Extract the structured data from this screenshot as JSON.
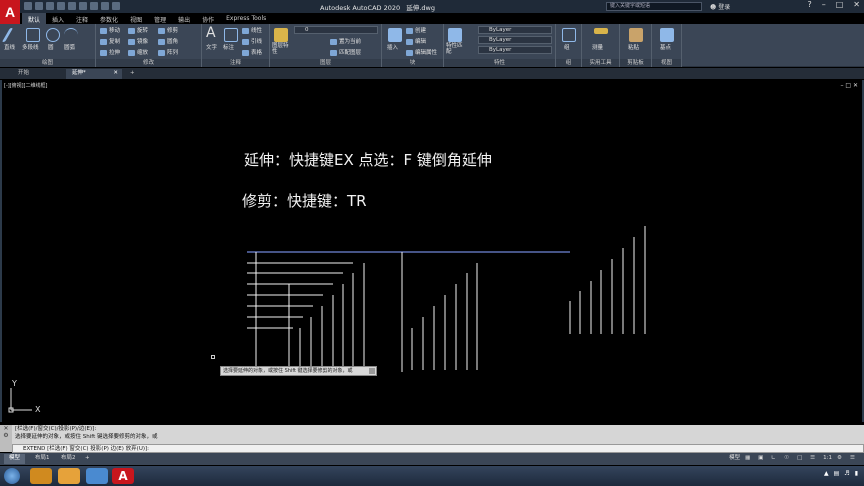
{
  "app": {
    "logo_text": "A",
    "title": "Autodesk AutoCAD 2020",
    "filename": "延伸.dwg",
    "search_placeholder": "键入关键字或短语",
    "login": "登录"
  },
  "ribbon_tabs": [
    "默认",
    "插入",
    "注释",
    "参数化",
    "视图",
    "管理",
    "输出",
    "协作",
    "Express Tools"
  ],
  "ribbon": {
    "draw": {
      "title": "绘图",
      "line": "直线",
      "polyline": "多段线",
      "circle": "圆",
      "arc": "圆弧"
    },
    "modify": {
      "title": "修改",
      "move": "移动",
      "rotate": "旋转",
      "trim": "修剪",
      "copy": "复制",
      "mirror": "镜像",
      "fillet": "圆角",
      "stretch": "拉伸",
      "scale": "缩放",
      "array": "阵列"
    },
    "annotation": {
      "title": "注释",
      "text": "文字",
      "dimension": "标注",
      "linear": "线性",
      "leader": "引线",
      "table": "表格"
    },
    "layers": {
      "title": "图层",
      "props": "图层特性",
      "layer_value": "0",
      "make_current": "置为当前",
      "match": "匹配图层"
    },
    "block": {
      "title": "块",
      "insert": "插入",
      "create": "创建",
      "edit": "编辑",
      "edit_attr": "编辑属性"
    },
    "properties": {
      "title": "特性",
      "match": "特性匹配",
      "color": "ByLayer",
      "linetype": "ByLayer",
      "lineweight": "ByLayer"
    },
    "groups": {
      "title": "组",
      "group": "组"
    },
    "utilities": {
      "title": "实用工具",
      "measure": "测量"
    },
    "clipboard": {
      "title": "剪贴板",
      "paste": "粘贴"
    },
    "view": {
      "title": "视图",
      "base": "基点"
    }
  },
  "doc_tabs": {
    "start": "开始",
    "current": "延伸*"
  },
  "viewport_label": "[-][俯视][二维线框]",
  "notes": {
    "line1": "延伸：快捷键EX   点选：F 键倒角延伸",
    "line2": "修剪：快捷键：TR"
  },
  "tooltip": "选择要延伸的对象，或按住 Shift 键选择要修剪的对象，或",
  "ucs": {
    "x": "X",
    "y": "Y"
  },
  "command": {
    "history1": "[栏选(F)/窗交(C)/投影(P)/边(E)]:",
    "history2": "选择要延伸的对象，或按住 Shift 键选择要修剪的对象，或",
    "current": "EXTEND [栏选(F) 窗交(C) 投影(P) 边(E) 放弃(U)]:"
  },
  "layout_tabs": [
    "模型",
    "布局1",
    "布局2",
    "+"
  ],
  "status": {
    "model": "模型",
    "scale": "1:1"
  }
}
